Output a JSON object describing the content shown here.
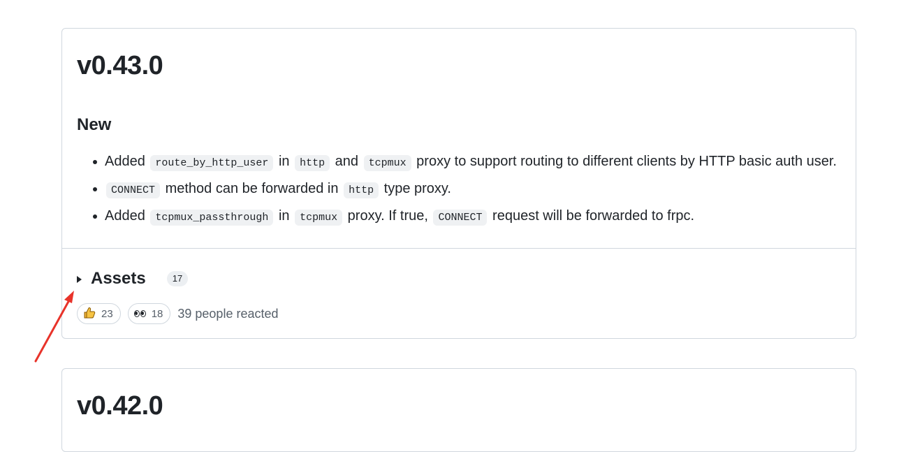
{
  "releases": [
    {
      "title": "v0.43.0",
      "section": "New",
      "notes": [
        {
          "parts": [
            {
              "t": "text",
              "v": "Added "
            },
            {
              "t": "code",
              "v": "route_by_http_user"
            },
            {
              "t": "text",
              "v": " in "
            },
            {
              "t": "code",
              "v": "http"
            },
            {
              "t": "text",
              "v": " and "
            },
            {
              "t": "code",
              "v": "tcpmux"
            },
            {
              "t": "text",
              "v": " proxy to support routing to different clients by HTTP basic auth user."
            }
          ]
        },
        {
          "parts": [
            {
              "t": "code",
              "v": "CONNECT"
            },
            {
              "t": "text",
              "v": " method can be forwarded in "
            },
            {
              "t": "code",
              "v": "http"
            },
            {
              "t": "text",
              "v": " type proxy."
            }
          ]
        },
        {
          "parts": [
            {
              "t": "text",
              "v": "Added "
            },
            {
              "t": "code",
              "v": "tcpmux_passthrough"
            },
            {
              "t": "text",
              "v": " in "
            },
            {
              "t": "code",
              "v": "tcpmux"
            },
            {
              "t": "text",
              "v": " proxy. If true, "
            },
            {
              "t": "code",
              "v": "CONNECT"
            },
            {
              "t": "text",
              "v": " request will be forwarded to frpc."
            }
          ]
        }
      ],
      "assets": {
        "label": "Assets",
        "count": "17"
      },
      "reactions": [
        {
          "icon": "thumbs-up-icon",
          "count": "23"
        },
        {
          "icon": "eyes-icon",
          "count": "18"
        }
      ],
      "reaction_summary": "39 people reacted"
    },
    {
      "title": "v0.42.0"
    }
  ],
  "colors": {
    "border": "#d0d7de",
    "code_bg": "#eff1f3",
    "annotation_arrow": "#e8332a"
  }
}
